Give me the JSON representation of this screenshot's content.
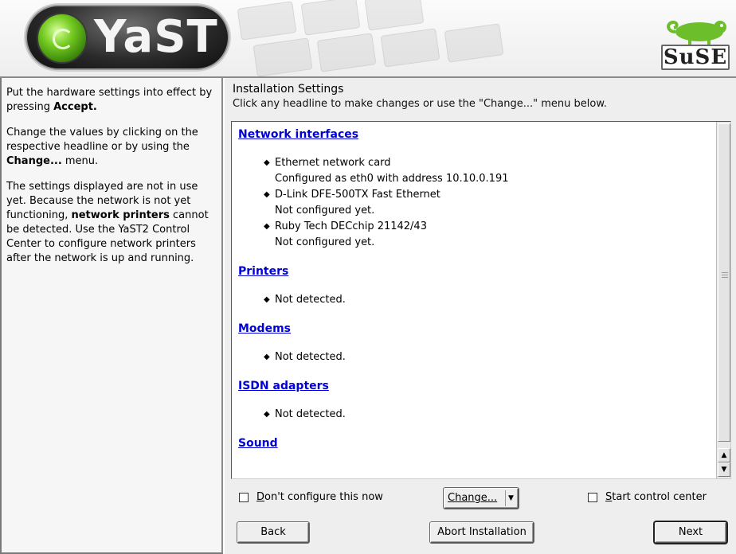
{
  "header": {
    "app_logo_text": "YaST",
    "vendor_logo_text": "SuSE"
  },
  "help": {
    "p1_a": "Put the hardware settings into effect by pressing ",
    "p1_b": "Accept.",
    "p2_a": "Change the values by clicking on the respective headline or by using the ",
    "p2_b": "Change...",
    "p2_c": " menu.",
    "p3_a": "The settings displayed are not in use yet. Because the network is not yet functioning, ",
    "p3_b": "network printers",
    "p3_c": " cannot be detected. Use the YaST2 Control Center to configure network printers after the network is up and running."
  },
  "main": {
    "title": "Installation Settings",
    "subtitle": "Click any headline to make changes or use the \"Change...\" menu below."
  },
  "sections": [
    {
      "heading": "Network interfaces",
      "items": [
        {
          "line1": "Ethernet network card",
          "line2": "Configured as eth0 with address 10.10.0.191"
        },
        {
          "line1": "D-Link DFE-500TX Fast Ethernet",
          "line2": "Not configured yet."
        },
        {
          "line1": "Ruby Tech DECchip 21142/43",
          "line2": "Not configured yet."
        }
      ]
    },
    {
      "heading": "Printers",
      "items": [
        {
          "line1": "Not detected."
        }
      ]
    },
    {
      "heading": "Modems",
      "items": [
        {
          "line1": "Not detected."
        }
      ]
    },
    {
      "heading": "ISDN adapters",
      "items": [
        {
          "line1": "Not detected."
        }
      ]
    },
    {
      "heading": "Sound",
      "items": []
    }
  ],
  "controls": {
    "dont_configure_label": "Don't configure this now",
    "dont_configure_checked": false,
    "change_label": "Change...",
    "start_cc_label": "Start control center",
    "start_cc_checked": false,
    "back_label": "Back",
    "abort_label": "Abort Installation",
    "next_label": "Next"
  },
  "scroll": {
    "position": 0.0
  }
}
